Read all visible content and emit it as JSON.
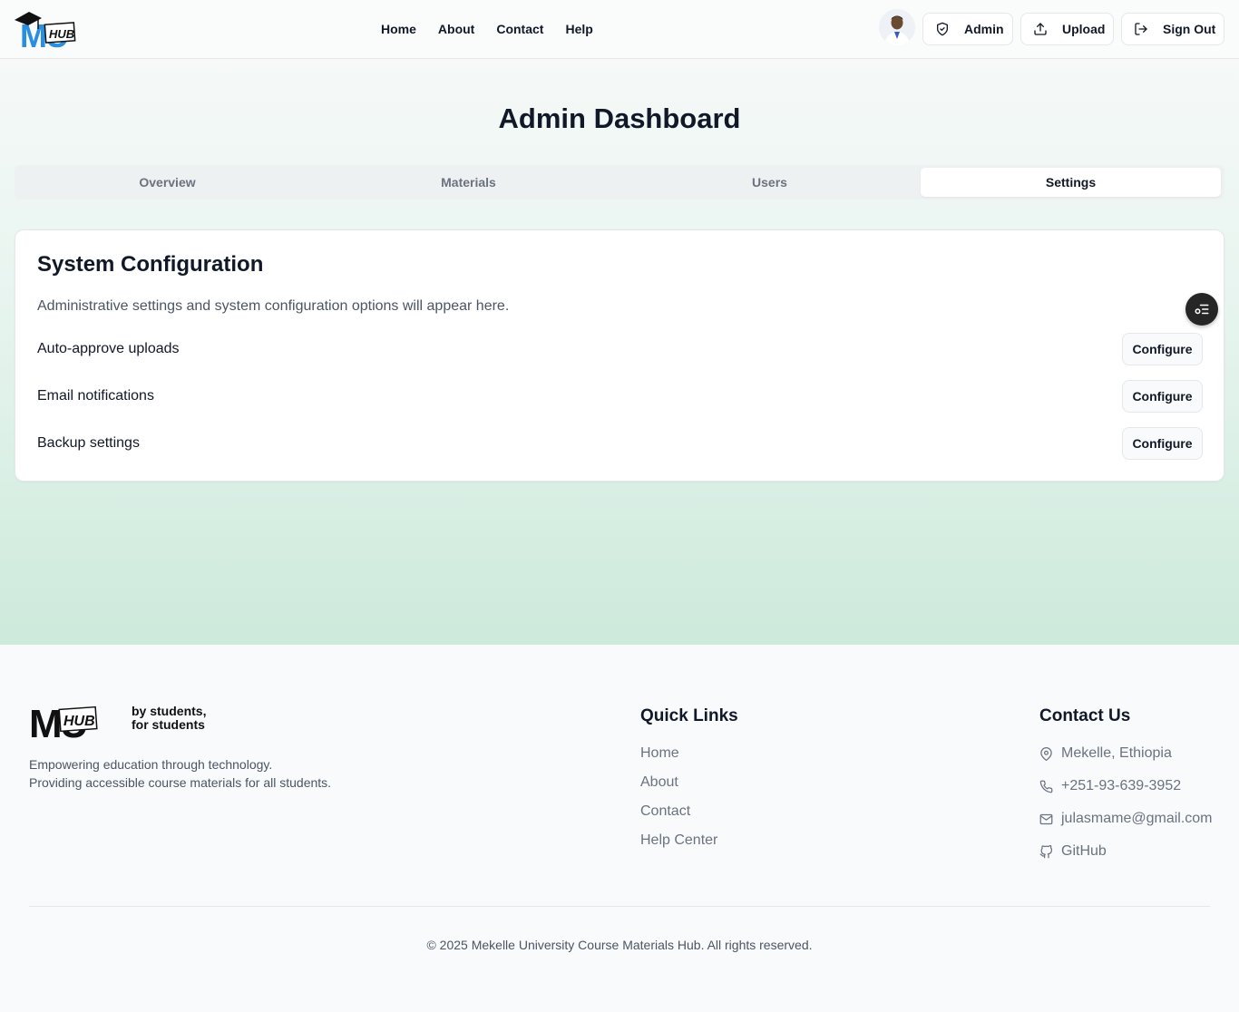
{
  "header": {
    "logo_text": "HUB",
    "nav": [
      "Home",
      "About",
      "Contact",
      "Help"
    ],
    "buttons": {
      "admin": "Admin",
      "upload": "Upload",
      "sign_out": "Sign Out"
    }
  },
  "main": {
    "title": "Admin Dashboard",
    "tabs": [
      "Overview",
      "Materials",
      "Users",
      "Settings"
    ],
    "active_tab": "Settings",
    "card": {
      "title": "System Configuration",
      "description": "Administrative settings and system configuration options will appear here.",
      "settings": [
        {
          "label": "Auto-approve uploads",
          "button": "Configure"
        },
        {
          "label": "Email notifications",
          "button": "Configure"
        },
        {
          "label": "Backup settings",
          "button": "Configure"
        }
      ]
    }
  },
  "footer": {
    "logo_text": "HUB",
    "tagline_line1": "by students,",
    "tagline_line2": "for students",
    "description_line1": "Empowering education through technology.",
    "description_line2": "Providing accessible course materials for all students.",
    "quick_links_title": "Quick Links",
    "quick_links": [
      "Home",
      "About",
      "Contact",
      "Help Center"
    ],
    "contact_title": "Contact Us",
    "contact": {
      "location": "Mekelle, Ethiopia",
      "phone": "+251-93-639-3952",
      "email": "julasmame@gmail.com",
      "github": "GitHub"
    },
    "copyright": "© 2025 Mekelle University Course Materials Hub. All rights reserved."
  },
  "colors": {
    "brand_blue": "#2a8fe0",
    "dark": "#111827",
    "muted": "#6b7280",
    "gradient_bottom": "#cdeadb"
  },
  "icons": {
    "admin": "shield-icon",
    "upload": "upload-icon",
    "sign_out": "log-out-icon",
    "location": "map-pin-icon",
    "phone": "phone-icon",
    "email": "mail-icon",
    "github": "github-icon",
    "floating": "settings-list-icon"
  }
}
